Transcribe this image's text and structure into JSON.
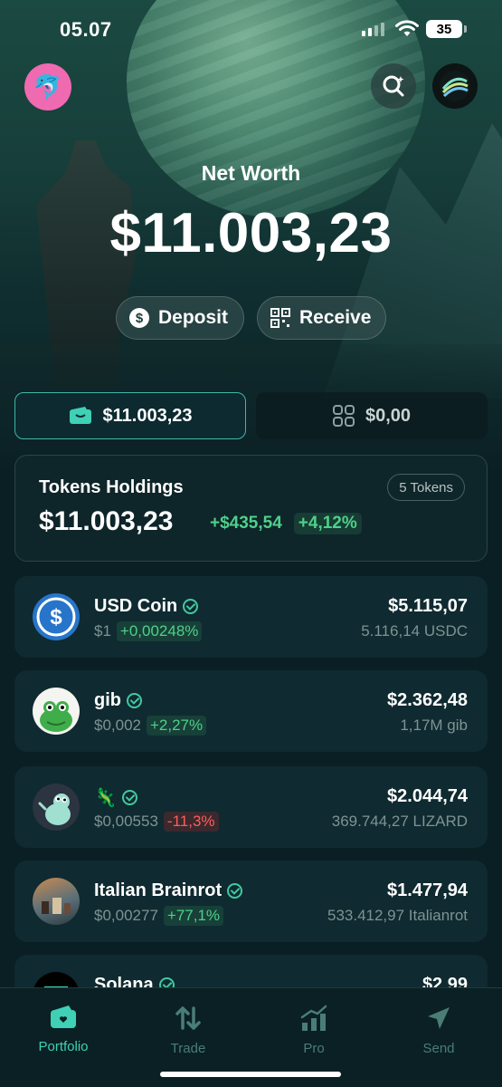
{
  "status": {
    "time": "05.07",
    "battery": "35"
  },
  "header": {
    "avatar_emoji": "🐬"
  },
  "net_worth": {
    "label": "Net Worth",
    "value": "$11.003,23"
  },
  "actions": {
    "deposit": "Deposit",
    "receive": "Receive"
  },
  "segments": {
    "tokens_value": "$11.003,23",
    "collectibles_value": "$0,00"
  },
  "holdings": {
    "title": "Tokens Holdings",
    "count": "5 Tokens",
    "value": "$11.003,23",
    "change_amount": "+$435,54",
    "change_percent": "+4,12%"
  },
  "tokens": [
    {
      "name": "USD Coin",
      "price": "$1",
      "change": "+0,00248%",
      "direction": "up",
      "value": "$5.115,07",
      "amount": "5.116,14 USDC"
    },
    {
      "name": "gib",
      "price": "$0,002",
      "change": "+2,27%",
      "direction": "up",
      "value": "$2.362,48",
      "amount": "1,17M gib"
    },
    {
      "name": "🦎",
      "price": "$0,00553",
      "change": "-11,3%",
      "direction": "down",
      "value": "$2.044,74",
      "amount": "369.744,27 LIZARD"
    },
    {
      "name": "Italian Brainrot",
      "price": "$0,00277",
      "change": "+77,1%",
      "direction": "up",
      "value": "$1.477,94",
      "amount": "533.412,97 Italianrot"
    },
    {
      "name": "Solana",
      "value": "$2,99"
    }
  ],
  "tabs": [
    {
      "label": "Portfolio",
      "icon": "wallet-icon",
      "active": true
    },
    {
      "label": "Trade",
      "icon": "swap-icon"
    },
    {
      "label": "Pro",
      "icon": "chart-icon"
    },
    {
      "label": "Send",
      "icon": "send-icon"
    }
  ],
  "colors": {
    "accent": "#3fd0b5",
    "gain": "#4fd08a",
    "loss": "#ff5d5d",
    "background": "#0a1f24"
  }
}
